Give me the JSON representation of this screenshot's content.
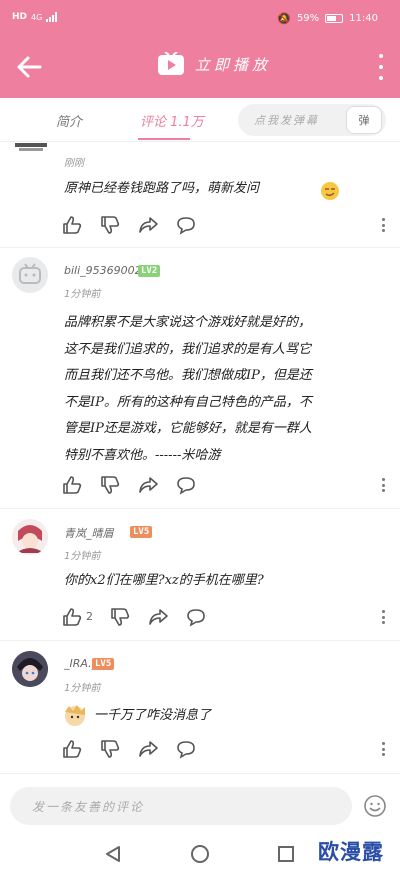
{
  "status_bar": {
    "network": "HD",
    "speed": "4G",
    "battery": "59%",
    "time": "11:40"
  },
  "header": {
    "title": "立即播放"
  },
  "tabs": [
    {
      "label": "简介"
    },
    {
      "label": "评论 1.1万"
    }
  ],
  "danmaku": {
    "placeholder": "点我发弹幕",
    "button": "弹"
  },
  "comments": [
    {
      "time": "刚刚",
      "text": "原神已经卷钱跑路了吗，萌新发问",
      "likes": ""
    },
    {
      "username": "bili_9536900228",
      "level": "LV2",
      "time": "1分钟前",
      "text_lines": [
        "品牌积累不是大家说这个游戏好就是好的，",
        "这不是我们追求的，我们追求的是有人骂它",
        "而且我们还不鸟他。我们想做成IP，但是还",
        "不是IP。所有的这种有自己特色的产品，不",
        "管是IP还是游戏，它能够好，就是有一群人",
        "特别不喜欢他。------米哈游"
      ],
      "likes": ""
    },
    {
      "username": "青岚_晴眉",
      "level": "LV5",
      "time": "1分钟前",
      "text": "你的x2们在哪里?xz的手机在哪里?",
      "likes": "2"
    },
    {
      "username": "_IRA._",
      "level": "LV5",
      "time": "1分钟前",
      "text": "一千万了咋没消息了",
      "likes": ""
    }
  ],
  "input": {
    "placeholder": "发一条友善的评论"
  },
  "watermark": "欧漫露",
  "colors": {
    "accent": "#ee7f9f",
    "level2": "#8ad27a",
    "level5": "#ef8e5d"
  }
}
